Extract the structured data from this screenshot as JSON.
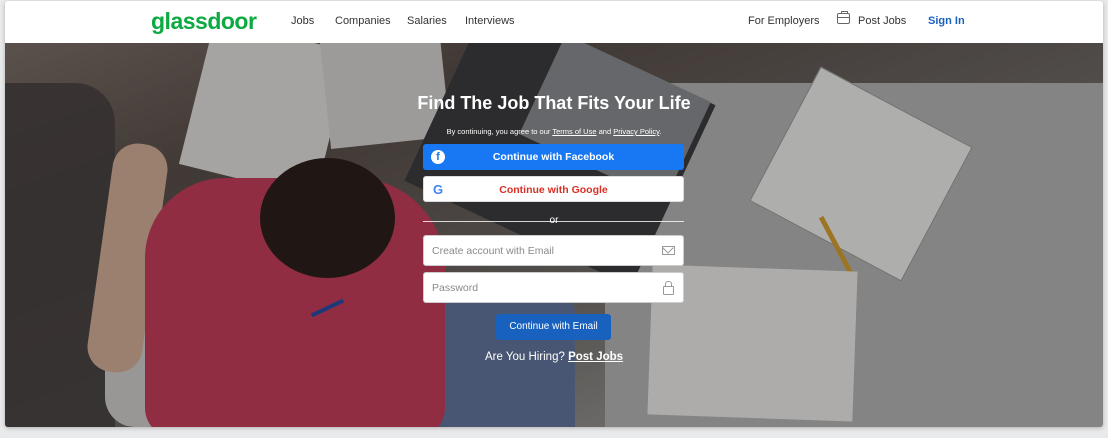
{
  "header": {
    "logo": "glassdoor",
    "nav": [
      "Jobs",
      "Companies",
      "Salaries",
      "Interviews"
    ],
    "for_employers": "For Employers",
    "post_jobs": "Post Jobs",
    "sign_in": "Sign In",
    "post_jobs_icon": "briefcase-icon"
  },
  "hero": {
    "headline": "Find The Job That Fits Your Life",
    "terms_prefix": "By continuing, you agree to our ",
    "terms_link": "Terms of Use",
    "terms_and": " and ",
    "privacy_link": "Privacy Policy",
    "terms_suffix": ".",
    "facebook_label": "Continue with Facebook",
    "facebook_icon": "f",
    "google_label": "Continue with Google",
    "google_icon": "G",
    "or": "or",
    "email_placeholder": "Create account with Email",
    "password_placeholder": "Password",
    "continue_email": "Continue with Email",
    "hiring_prefix": "Are You Hiring? ",
    "hiring_link": "Post Jobs"
  },
  "colors": {
    "brand": "#0caa41",
    "facebook": "#1877f2",
    "primary": "#1861bf",
    "google_text": "#d93025"
  }
}
